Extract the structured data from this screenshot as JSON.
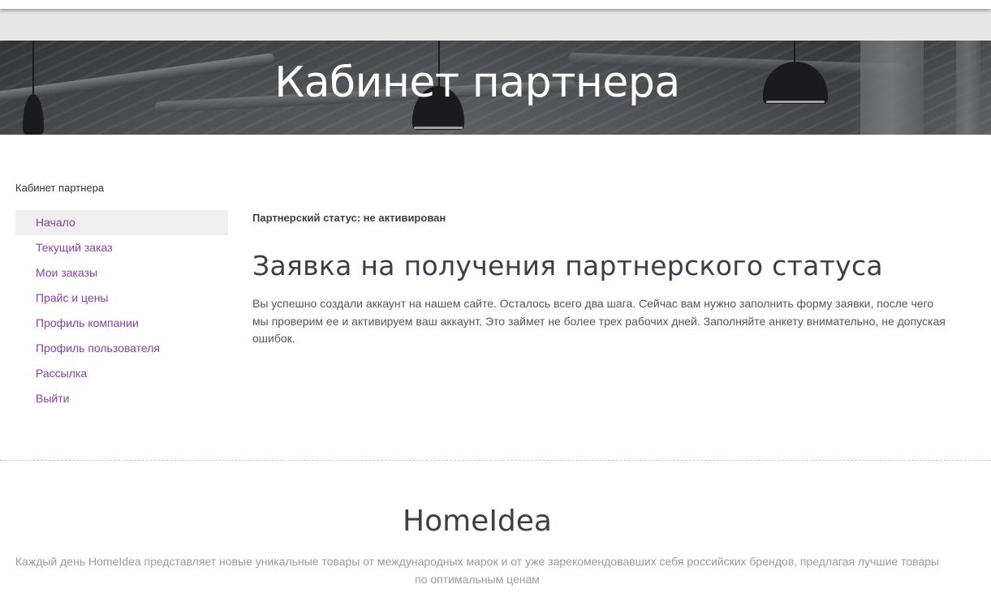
{
  "hero": {
    "title": "Кабинет партнера"
  },
  "sidebar": {
    "title": "Кабинет партнера",
    "items": [
      {
        "label": "Начало",
        "active": true
      },
      {
        "label": "Текущий заказ",
        "active": false
      },
      {
        "label": "Мои заказы",
        "active": false
      },
      {
        "label": "Прайс и цены",
        "active": false
      },
      {
        "label": "Профиль компании",
        "active": false
      },
      {
        "label": "Профиль пользователя",
        "active": false
      },
      {
        "label": "Рассылка",
        "active": false
      },
      {
        "label": "Выйти",
        "active": false
      }
    ]
  },
  "main": {
    "status": "Партнерский статус: не активирован",
    "heading": "Заявка на получения партнерского статуса",
    "intro": "Вы успешно создали аккаунт на нашем сайте. Осталось всего два шага. Сейчас вам нужно заполнить форму заявки, после чего мы проверим ее и активируем ваш аккаунт. Это займет не более трех рабочих дней. Заполняйте анкету внимательно, не допуская ошибок."
  },
  "footer": {
    "brand": "HomeIdea",
    "tagline": "Каждый день HomeIdea представляет новые уникальные товары от международных марок и от уже зарекомендовавших себя российских брендов, предлагая лучшие товары по оптимальным ценам"
  },
  "colors": {
    "link": "#8a3fa3",
    "active_bg": "#efefef",
    "heading": "#3c3f4a"
  }
}
